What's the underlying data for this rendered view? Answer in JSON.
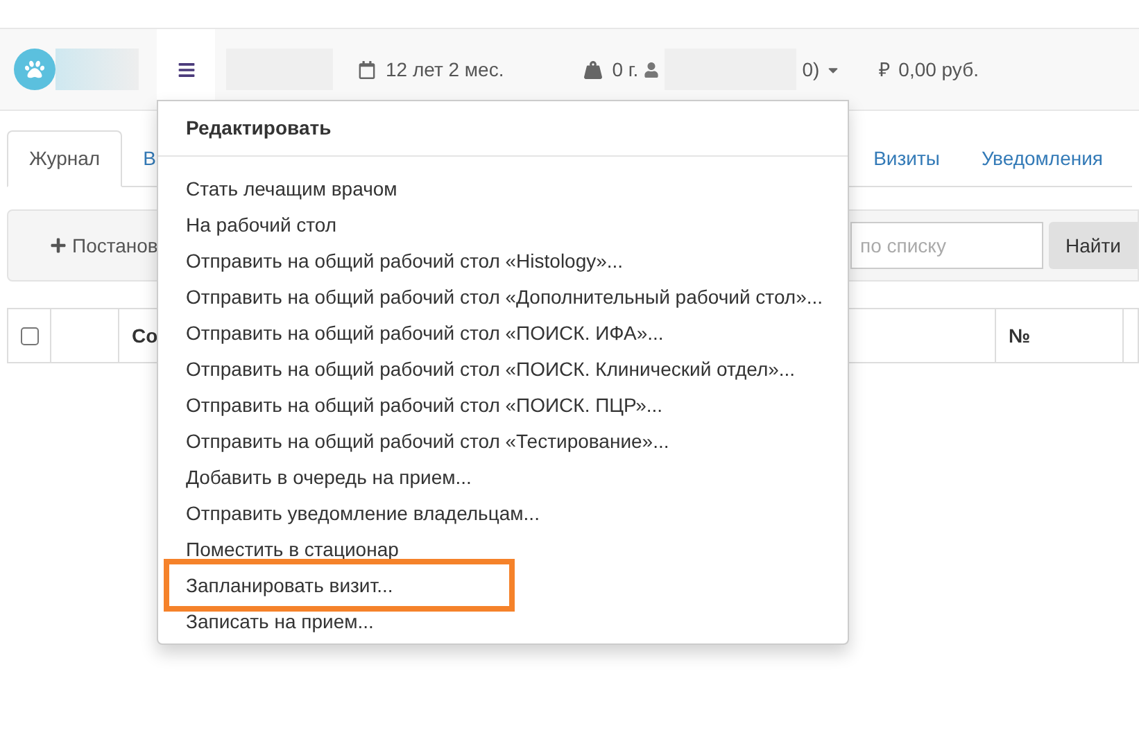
{
  "header": {
    "age": "12 лет 2 мес.",
    "weight": "0 г.",
    "owner_tail": "0)",
    "currency": "₽",
    "balance": "0,00 руб."
  },
  "tabs": [
    {
      "label": "Журнал",
      "selected": true
    },
    {
      "label": "В",
      "selected": false
    },
    {
      "label": "Визиты",
      "selected": false
    },
    {
      "label": "Уведомления",
      "selected": false
    }
  ],
  "toolbar": {
    "add_button": "Постанов",
    "search": {
      "placeholder": "по списку"
    },
    "find_button": "Найти"
  },
  "table": {
    "select_all": {
      "checked": false
    },
    "columns": [
      {
        "label": "Со"
      },
      {
        "label": "№"
      }
    ]
  },
  "menu": {
    "title": "Редактировать",
    "items": [
      {
        "label": "Стать лечащим врачом",
        "highlighted": false
      },
      {
        "label": "На рабочий стол",
        "highlighted": false
      },
      {
        "label": "Отправить на общий рабочий стол «Histology»...",
        "highlighted": false
      },
      {
        "label": "Отправить на общий рабочий стол «Дополнительный рабочий стол»...",
        "highlighted": false
      },
      {
        "label": "Отправить на общий рабочий стол «ПОИСК. ИФА»...",
        "highlighted": false
      },
      {
        "label": "Отправить на общий рабочий стол «ПОИСК. Клинический отдел»...",
        "highlighted": false
      },
      {
        "label": "Отправить на общий рабочий стол «ПОИСК. ПЦР»...",
        "highlighted": false
      },
      {
        "label": "Отправить на общий рабочий стол «Тестирование»...",
        "highlighted": false
      },
      {
        "label": "Добавить в очередь на прием...",
        "highlighted": false
      },
      {
        "label": "Отправить уведомление владельцам...",
        "highlighted": false
      },
      {
        "label": "Поместить в стационар",
        "highlighted": false
      },
      {
        "label": "Запланировать визит...",
        "highlighted": true
      },
      {
        "label": "Записать на прием...",
        "highlighted": false
      }
    ]
  }
}
